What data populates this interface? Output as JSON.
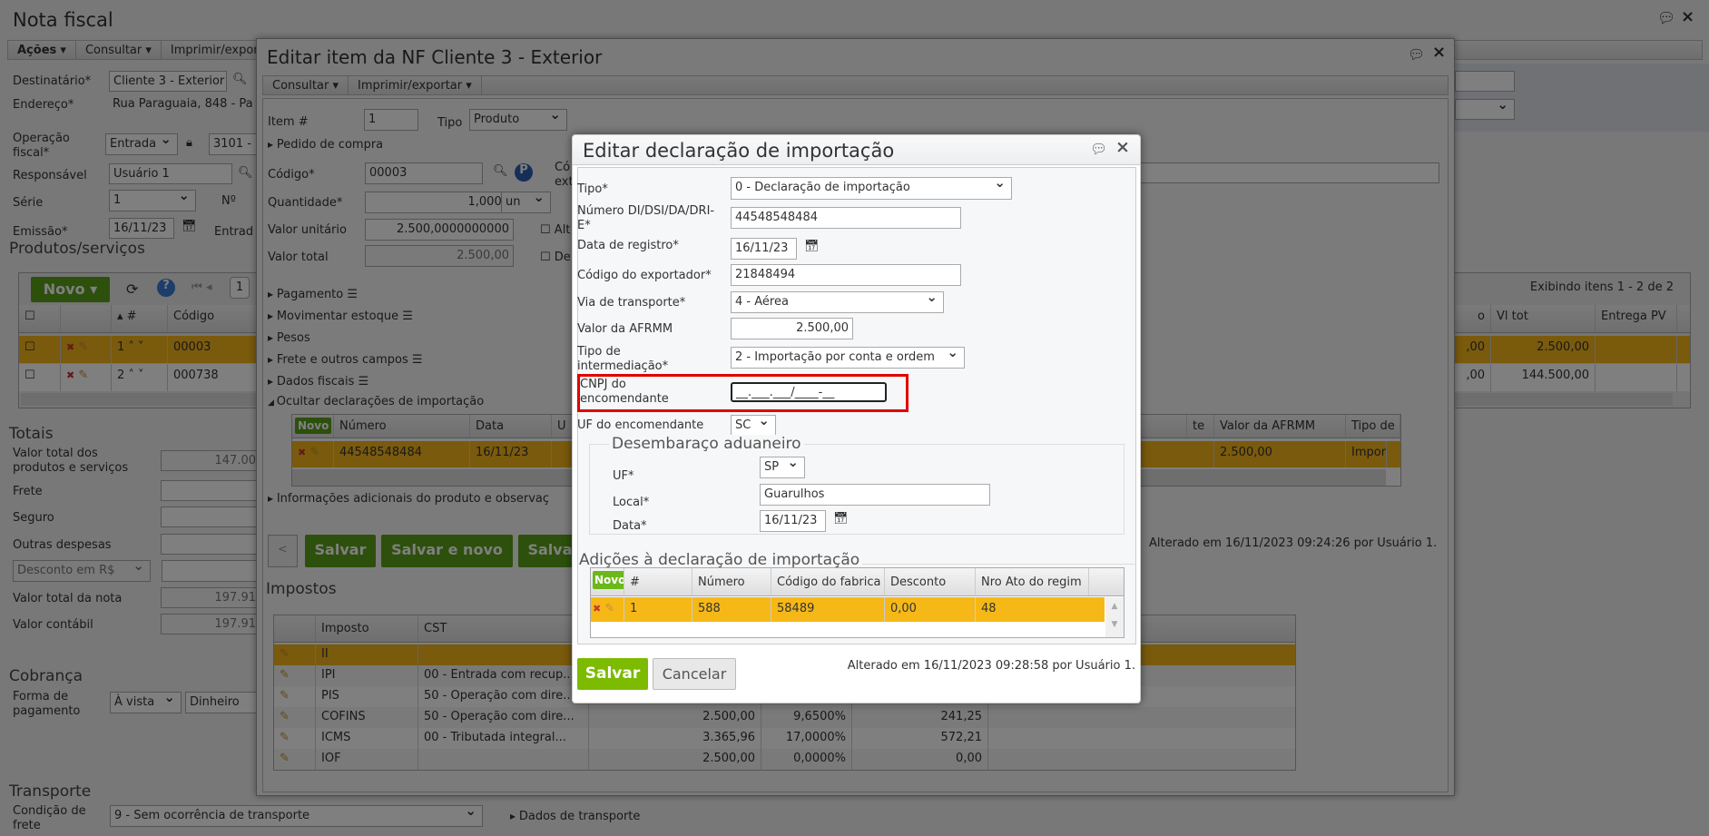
{
  "page": {
    "title": "Nota fiscal",
    "toolbar": [
      "Ações",
      "Consultar",
      "Imprimir/exportar"
    ],
    "form": {
      "destinatario_label": "Destinatário*",
      "destinatario": "Cliente 3 - Exterior",
      "endereco_label": "Endereço*",
      "endereco": "Rua Paraguaia, 848 - Pa",
      "operacao_label": "Operação fiscal*",
      "operacao": "Entrada",
      "cfop": "3101 -",
      "responsavel_label": "Responsável",
      "responsavel": "Usuário 1",
      "serie_label": "Série",
      "serie": "1",
      "numero_label": "Nº",
      "emissao_label": "Emissão*",
      "emissao": "16/11/23",
      "entrada_label": "Entrad"
    },
    "produtos": {
      "heading": "Produtos/serviços",
      "novo": "Novo",
      "page": "1",
      "pager_info": "Exibindo itens 1 - 2 de 2",
      "columns": [
        "#",
        "Código",
        "o",
        "Vl tot",
        "Entrega PV"
      ],
      "rows": [
        {
          "n": "1",
          "codigo": "00003",
          "partial": ",00",
          "vltot": "2.500,00"
        },
        {
          "n": "2",
          "codigo": "000738",
          "partial": ",00",
          "vltot": "144.500,00"
        }
      ]
    },
    "totais": {
      "heading": "Totais",
      "rows": [
        {
          "label": "Valor total dos produtos e serviços",
          "value": "147.00"
        },
        {
          "label": "Frete",
          "value": ""
        },
        {
          "label": "Seguro",
          "value": ""
        },
        {
          "label": "Outras despesas",
          "value": ""
        },
        {
          "label": "Desconto em R$",
          "value": ""
        },
        {
          "label": "Valor total da nota",
          "value": "197.91"
        },
        {
          "label": "Valor contábil",
          "value": "197.91"
        }
      ]
    },
    "cobranca": {
      "heading": "Cobrança",
      "label": "Forma de pagamento",
      "forma": "À vista",
      "meio": "Dinheiro"
    },
    "transporte": {
      "heading": "Transporte",
      "label": "Condição de frete",
      "value": "9 - Sem ocorrência de transporte",
      "link": "Dados de transporte"
    }
  },
  "item_dialog": {
    "title": "Editar item da NF Cliente 3 - Exterior",
    "toolbar": [
      "Consultar",
      "Imprimir/exportar"
    ],
    "item_label": "Item #",
    "item": "1",
    "tipo_label": "Tipo",
    "tipo": "Produto",
    "pedido": "Pedido de compra",
    "codigo_label": "Código*",
    "codigo": "00003",
    "codigo_ext_label": "Có ext",
    "quantidade_label": "Quantidade*",
    "quantidade": "1,0000",
    "unidade": "un",
    "valor_unitario_label": "Valor unitário",
    "valor_unitario": "2.500,0000000000",
    "alt_label": "Alt",
    "valor_total_label": "Valor total",
    "valor_total": "2.500,00",
    "de_label": "De",
    "sections": [
      "Pagamento",
      "Movimentar estoque",
      "Pesos",
      "Frete e outros campos",
      "Dados fiscais"
    ],
    "ocultar": "Ocultar declarações de importação",
    "di_grid": {
      "novo": "Novo",
      "columns": [
        "Número",
        "Data",
        "U",
        "te",
        "Valor da AFRMM",
        "Tipo de inte"
      ],
      "row": {
        "numero": "44548548484",
        "data": "16/11/23",
        "afrmm": "2.500,00",
        "tipo": "Importação"
      }
    },
    "info_adicionais": "Informações adicionais do produto e observaç",
    "buttons": [
      "<",
      "Salvar",
      "Salvar e novo",
      "Salva"
    ],
    "alterado": "Alterado em 16/11/2023 09:24:26 por Usuário 1.",
    "impostos": {
      "heading": "Impostos",
      "columns": [
        "Imposto",
        "CST"
      ],
      "rows": [
        {
          "imposto": "II",
          "cst": "",
          "base": "",
          "aliq": "",
          "valor": ""
        },
        {
          "imposto": "IPI",
          "cst": "00 - Entrada com recup...",
          "base": "",
          "aliq": "",
          "valor": ""
        },
        {
          "imposto": "PIS",
          "cst": "50 - Operação com dire...",
          "base": "",
          "aliq": "",
          "valor": ""
        },
        {
          "imposto": "COFINS",
          "cst": "50 - Operação com dire...",
          "base": "2.500,00",
          "aliq": "9,6500%",
          "valor": "241,25"
        },
        {
          "imposto": "ICMS",
          "cst": "00 - Tributada integral...",
          "base": "3.365,96",
          "aliq": "17,0000%",
          "valor": "572,21"
        },
        {
          "imposto": "IOF",
          "cst": "",
          "base": "2.500,00",
          "aliq": "0,0000%",
          "valor": "0,00"
        }
      ]
    }
  },
  "di_dialog": {
    "title": "Editar declaração de importação",
    "tipo_label": "Tipo*",
    "tipo": "0 - Declaração de importação",
    "numero_label": "Número DI/DSI/DA/DRI-E*",
    "numero": "44548548484",
    "data_registro_label": "Data de registro*",
    "data_registro": "16/11/23",
    "exportador_label": "Código do exportador*",
    "exportador": "21848494",
    "via_label": "Via de transporte*",
    "via": "4 - Aérea",
    "afrmm_label": "Valor da AFRMM",
    "afrmm": "2.500,00",
    "intermediacao_label": "Tipo de intermediação*",
    "intermediacao": "2 - Importação por conta e ordem",
    "cnpj_label": "CNPJ do encomendante",
    "cnpj": "__.___.___/____-__",
    "uf_enc_label": "UF do encomendante",
    "uf_enc": "SC",
    "desembaraco": {
      "legend": "Desembaraço aduaneiro",
      "uf_label": "UF*",
      "uf": "SP",
      "local_label": "Local*",
      "local": "Guarulhos",
      "data_label": "Data*",
      "data": "16/11/23"
    },
    "adicoes": {
      "legend": "Adições à declaração de importação",
      "novo": "Novo",
      "columns": [
        "#",
        "Número",
        "Código do fabrica",
        "Desconto",
        "Nro Ato do regim"
      ],
      "row": {
        "n": "1",
        "numero": "588",
        "codigo": "58489",
        "desconto": "0,00",
        "ato": "48"
      }
    },
    "salvar": "Salvar",
    "cancelar": "Cancelar",
    "alterado": "Alterado em 16/11/2023 09:28:58 por Usuário 1.",
    "highlight_color": "#e00000"
  }
}
